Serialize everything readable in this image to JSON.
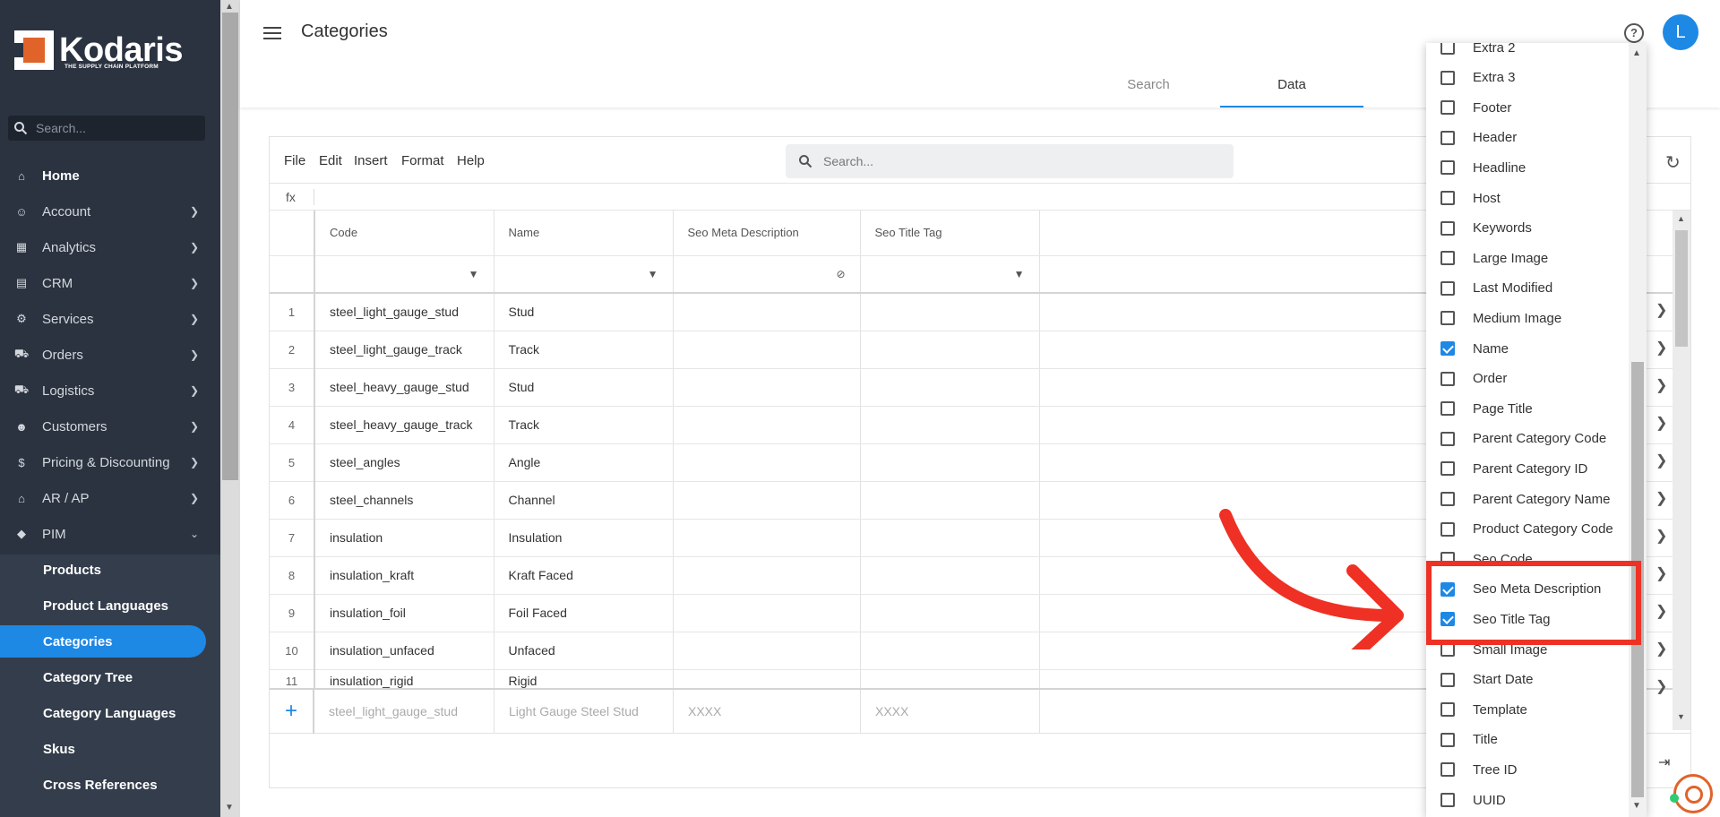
{
  "brand": {
    "name": "Kodaris",
    "tagline": "THE SUPPLY CHAIN PLATFORM",
    "accent": "#e0632a",
    "primary": "#1e88e5"
  },
  "sidebar": {
    "search_placeholder": "Search...",
    "items": [
      {
        "label": "Home",
        "icon": "home-icon"
      },
      {
        "label": "Account",
        "icon": "account-icon"
      },
      {
        "label": "Analytics",
        "icon": "analytics-icon"
      },
      {
        "label": "CRM",
        "icon": "crm-icon"
      },
      {
        "label": "Services",
        "icon": "services-icon"
      },
      {
        "label": "Orders",
        "icon": "orders-icon"
      },
      {
        "label": "Logistics",
        "icon": "logistics-icon"
      },
      {
        "label": "Customers",
        "icon": "customers-icon"
      },
      {
        "label": "Pricing & Discounting",
        "icon": "dollar-icon"
      },
      {
        "label": "AR / AP",
        "icon": "bank-icon"
      },
      {
        "label": "PIM",
        "icon": "tag-icon"
      }
    ],
    "pim_items": [
      "Products",
      "Product Languages",
      "Categories",
      "Category Tree",
      "Category Languages",
      "Skus",
      "Cross References"
    ],
    "active": "Categories"
  },
  "header": {
    "title": "Categories",
    "tabs": [
      "Search",
      "Data"
    ],
    "active_tab": "Data",
    "avatar_initial": "L"
  },
  "toolbar": {
    "menus": [
      "File",
      "Edit",
      "Insert",
      "Format",
      "Help"
    ],
    "search_placeholder": "Search...",
    "fx_label": "fx"
  },
  "grid": {
    "columns": [
      "Code",
      "Name",
      "Seo Meta Description",
      "Seo Title Tag"
    ],
    "rows": [
      {
        "n": "1",
        "code": "steel_light_gauge_stud",
        "name": "Stud"
      },
      {
        "n": "2",
        "code": "steel_light_gauge_track",
        "name": "Track"
      },
      {
        "n": "3",
        "code": "steel_heavy_gauge_stud",
        "name": "Stud"
      },
      {
        "n": "4",
        "code": "steel_heavy_gauge_track",
        "name": "Track"
      },
      {
        "n": "5",
        "code": "steel_angles",
        "name": "Angle"
      },
      {
        "n": "6",
        "code": "steel_channels",
        "name": "Channel"
      },
      {
        "n": "7",
        "code": "insulation",
        "name": "Insulation"
      },
      {
        "n": "8",
        "code": "insulation_kraft",
        "name": "Kraft Faced"
      },
      {
        "n": "9",
        "code": "insulation_foil",
        "name": "Foil Faced"
      },
      {
        "n": "10",
        "code": "insulation_unfaced",
        "name": "Unfaced"
      },
      {
        "n": "11",
        "code": "insulation_rigid",
        "name": "Rigid"
      }
    ],
    "new_row": {
      "code": "steel_light_gauge_stud",
      "name": "Light Gauge Steel Stud",
      "seo_meta": "XXXX",
      "seo_title": "XXXX"
    }
  },
  "column_picker": {
    "items": [
      {
        "label": "Extra 2",
        "checked": false
      },
      {
        "label": "Extra 3",
        "checked": false
      },
      {
        "label": "Footer",
        "checked": false
      },
      {
        "label": "Header",
        "checked": false
      },
      {
        "label": "Headline",
        "checked": false
      },
      {
        "label": "Host",
        "checked": false
      },
      {
        "label": "Keywords",
        "checked": false
      },
      {
        "label": "Large Image",
        "checked": false
      },
      {
        "label": "Last Modified",
        "checked": false
      },
      {
        "label": "Medium Image",
        "checked": false
      },
      {
        "label": "Name",
        "checked": true
      },
      {
        "label": "Order",
        "checked": false
      },
      {
        "label": "Page Title",
        "checked": false
      },
      {
        "label": "Parent Category Code",
        "checked": false
      },
      {
        "label": "Parent Category ID",
        "checked": false
      },
      {
        "label": "Parent Category Name",
        "checked": false
      },
      {
        "label": "Product Category Code",
        "checked": false
      },
      {
        "label": "Seo Code",
        "checked": false
      },
      {
        "label": "Seo Meta Description",
        "checked": true
      },
      {
        "label": "Seo Title Tag",
        "checked": true
      },
      {
        "label": "Small Image",
        "checked": false
      },
      {
        "label": "Start Date",
        "checked": false
      },
      {
        "label": "Template",
        "checked": false
      },
      {
        "label": "Title",
        "checked": false
      },
      {
        "label": "Tree ID",
        "checked": false
      },
      {
        "label": "UUID",
        "checked": false
      }
    ]
  },
  "annotation": {
    "color": "#ee3124"
  }
}
